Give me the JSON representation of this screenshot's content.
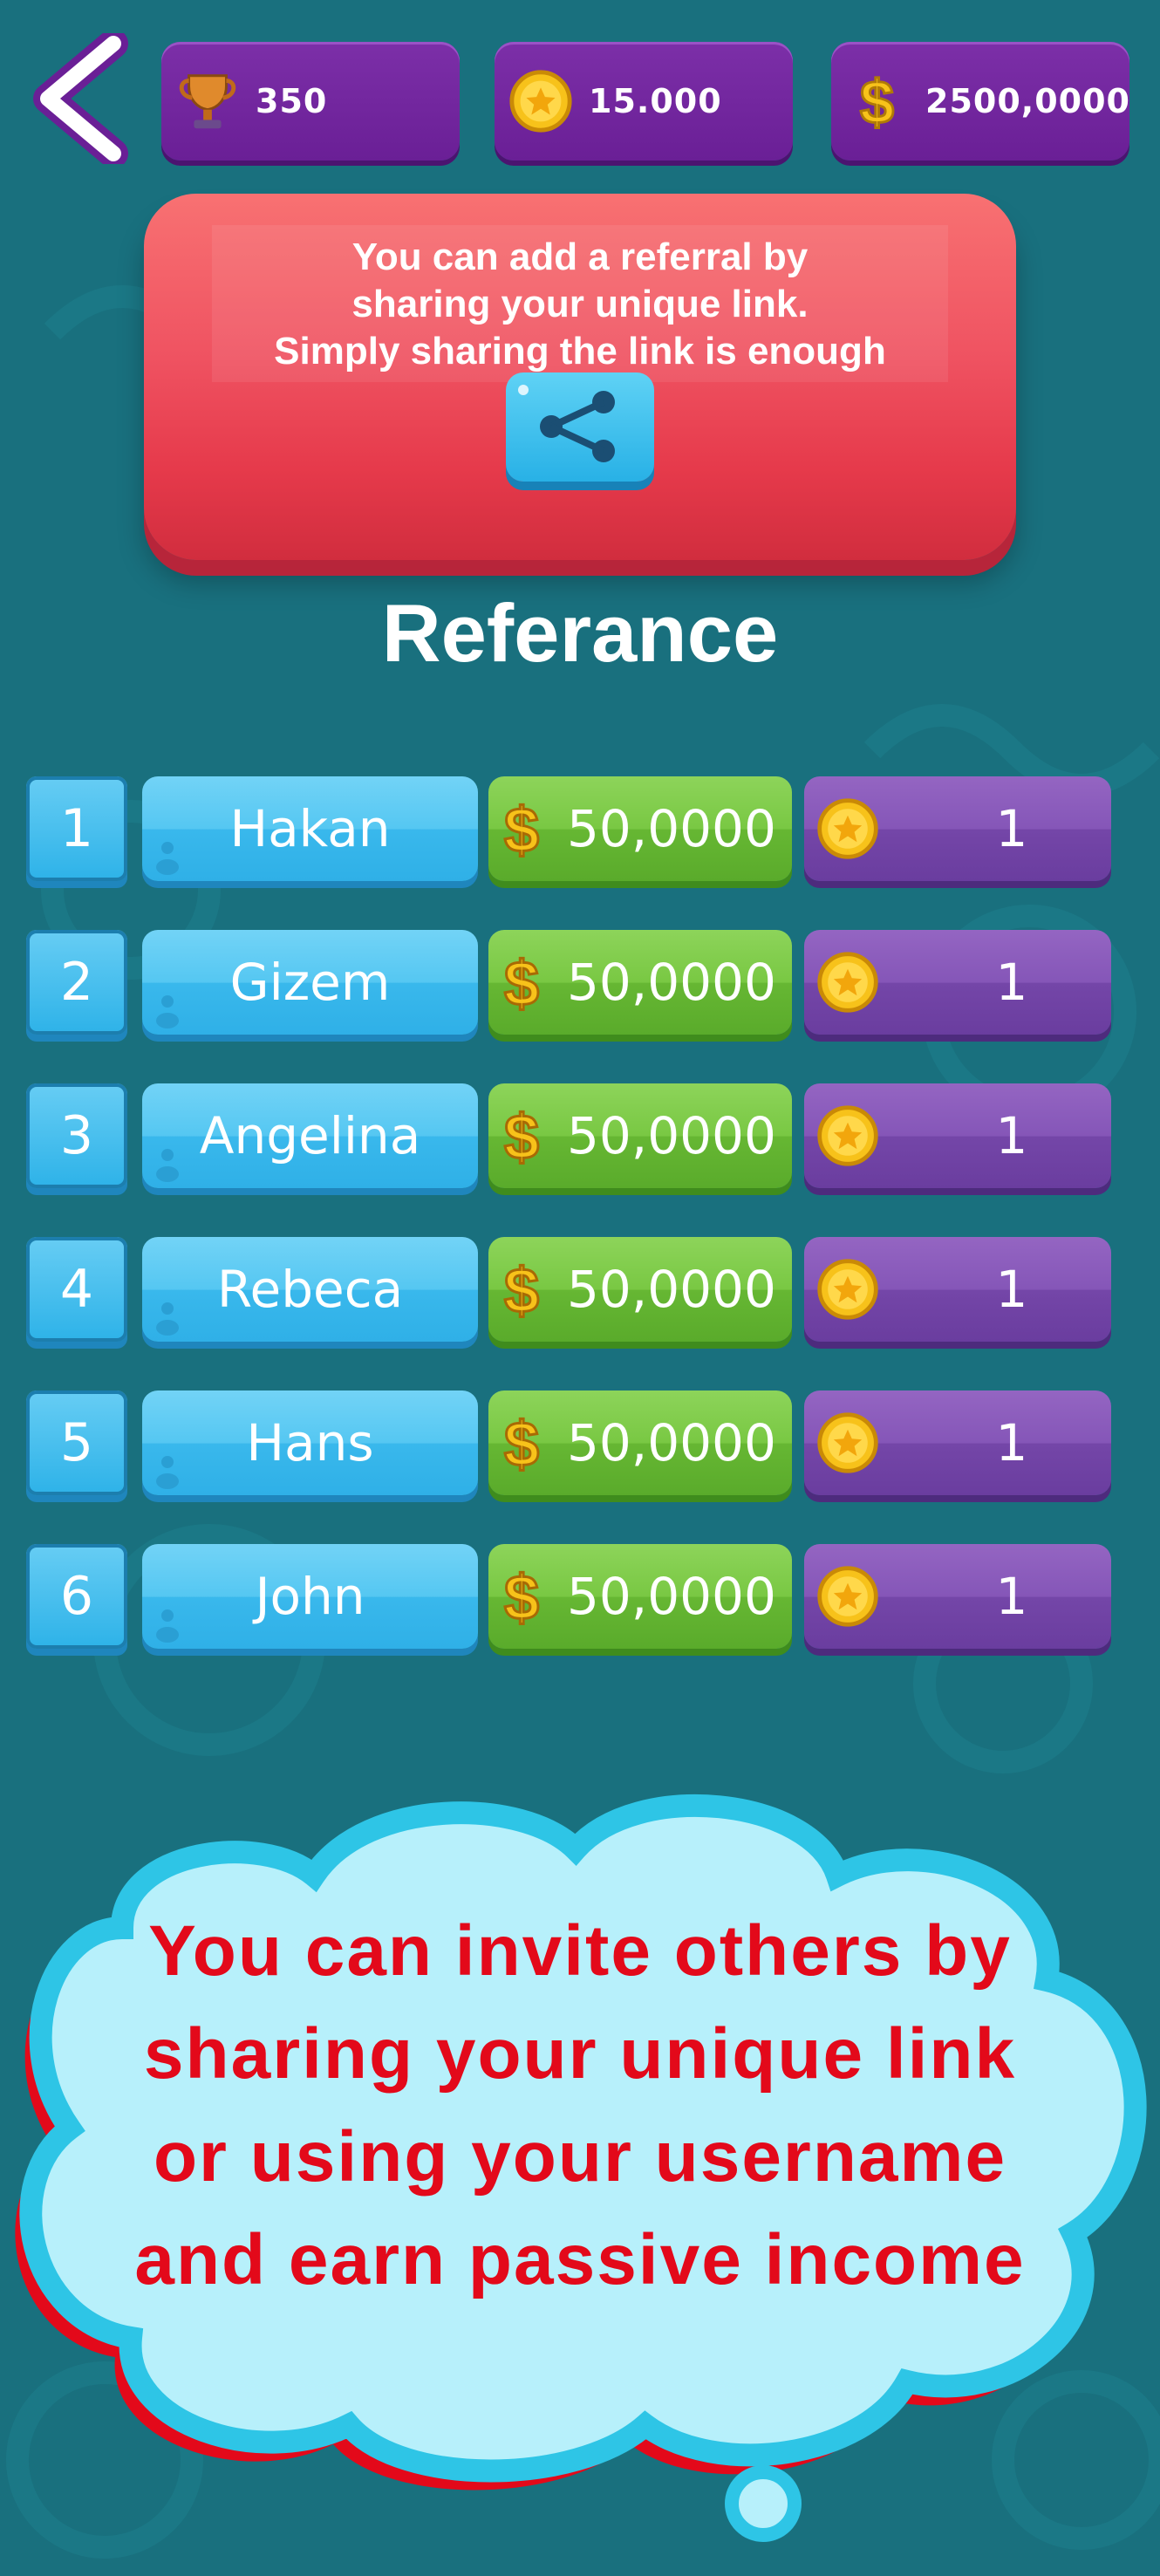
{
  "header": {
    "stats": [
      {
        "icon": "trophy-icon",
        "value": "350"
      },
      {
        "icon": "coin-icon",
        "value": "15.000"
      },
      {
        "icon": "dollar-icon",
        "value": "2500,0000"
      }
    ]
  },
  "referral_card": {
    "lines": [
      "You can add a referral by",
      "sharing your unique link.",
      "Simply sharing the link is enough"
    ]
  },
  "section_title": "Referance",
  "referrals": [
    {
      "rank": "1",
      "name": "Hakan",
      "cash": "50,0000",
      "coins": "1"
    },
    {
      "rank": "2",
      "name": "Gizem",
      "cash": "50,0000",
      "coins": "1"
    },
    {
      "rank": "3",
      "name": "Angelina",
      "cash": "50,0000",
      "coins": "1"
    },
    {
      "rank": "4",
      "name": "Rebeca",
      "cash": "50,0000",
      "coins": "1"
    },
    {
      "rank": "5",
      "name": "Hans",
      "cash": "50,0000",
      "coins": "1"
    },
    {
      "rank": "6",
      "name": "John",
      "cash": "50,0000",
      "coins": "1"
    }
  ],
  "promo_cloud": {
    "lines": [
      "You can invite others by",
      "sharing your unique link",
      "or using your username",
      "and earn passive income"
    ]
  },
  "colors": {
    "background": "#19707e",
    "pill": "#6a1f96",
    "card": "#ef5261",
    "share": "#28b1e6",
    "promo_text": "#e3091a"
  }
}
